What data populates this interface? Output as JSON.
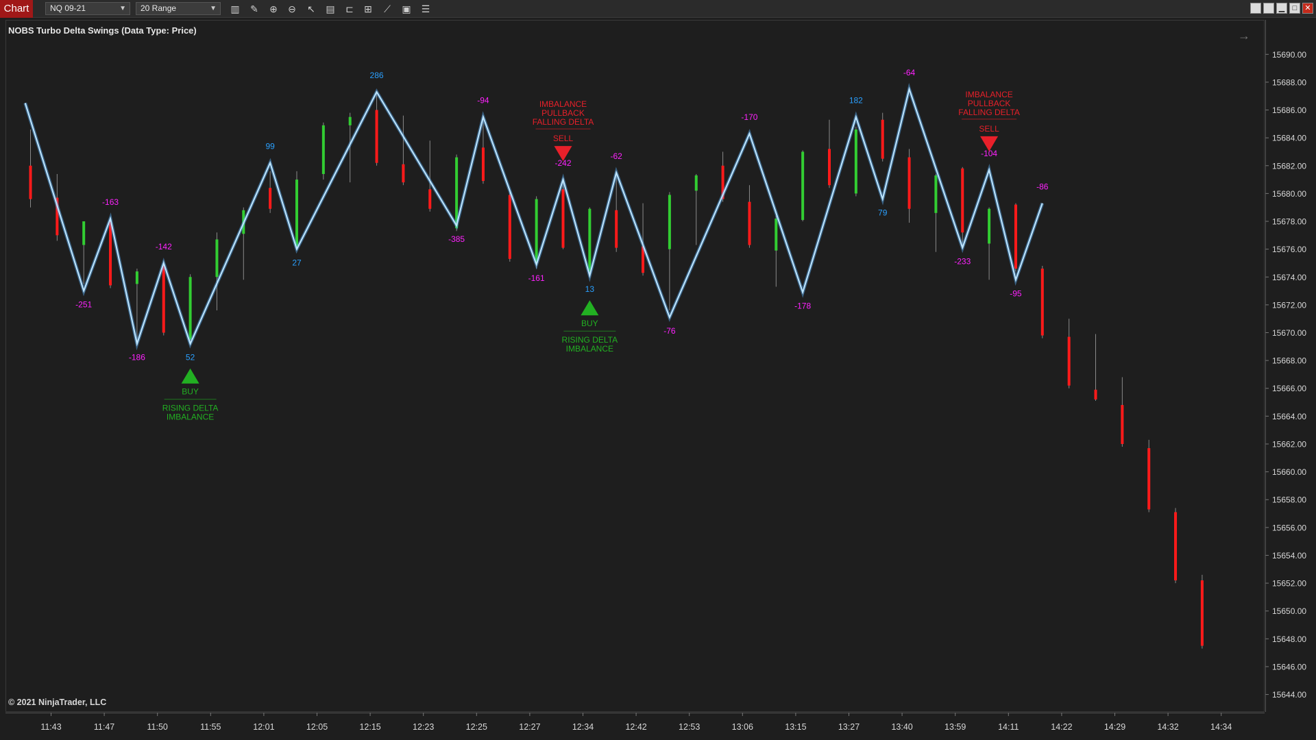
{
  "toolbar": {
    "app_tab": "Chart",
    "instrument": "NQ 09-21",
    "interval": "20 Range",
    "tools": [
      "bar-chart-icon",
      "pencil-icon",
      "zoom-in-icon",
      "zoom-out-icon",
      "pointer-icon",
      "data-box-icon",
      "strategy-icon",
      "indicators-icon",
      "drawing-tools-icon",
      "properties-icon",
      "list-icon"
    ]
  },
  "window_controls": [
    "tile-icon",
    "restore-icon",
    "minimize-icon",
    "maximize-icon",
    "close-icon"
  ],
  "chart": {
    "title": "NOBS Turbo Delta Swings (Data Type: Price)",
    "copyright": "© 2021 NinjaTrader, LLC",
    "nav_arrow": "→"
  },
  "colors": {
    "background": "#1e1e1e",
    "up_bar": "#32cd32",
    "down_bar": "#ff1a1a",
    "swing_line": "#5ab4ff",
    "swing_positive_label": "#2aa0ff",
    "swing_negative_label": "#ff22ff",
    "buy_signal": "#22b022",
    "sell_signal": "#e8202a"
  },
  "chart_data": {
    "type": "candlestick-with-swing-overlay",
    "price_axis": {
      "ticks": [
        "15690.00",
        "15688.00",
        "15686.00",
        "15684.00",
        "15682.00",
        "15680.00",
        "15678.00",
        "15676.00",
        "15674.00",
        "15672.00",
        "15670.00",
        "15668.00",
        "15666.00",
        "15664.00",
        "15662.00",
        "15660.00",
        "15658.00",
        "15656.00",
        "15654.00",
        "15652.00",
        "15650.00",
        "15648.00",
        "15646.00",
        "15644.00"
      ],
      "ylim": [
        15643.5,
        15691.5
      ]
    },
    "time_axis": {
      "ticks": [
        "11:43",
        "11:47",
        "11:50",
        "11:55",
        "12:01",
        "12:05",
        "12:15",
        "12:23",
        "12:25",
        "12:27",
        "12:34",
        "12:42",
        "12:53",
        "13:06",
        "13:15",
        "13:27",
        "13:40",
        "13:59",
        "14:11",
        "14:22",
        "14:29",
        "14:32",
        "14:34"
      ]
    },
    "candles": [
      {
        "i": 0,
        "o": 15682.0,
        "c": 15679.6,
        "h": 15684.6,
        "l": 15679.0
      },
      {
        "i": 1,
        "o": 15679.7,
        "c": 15677.0,
        "h": 15681.4,
        "l": 15676.6
      },
      {
        "i": 2,
        "o": 15676.3,
        "c": 15678.0,
        "h": 15678.0,
        "l": 15673.5
      },
      {
        "i": 3,
        "o": 15678.0,
        "c": 15673.4,
        "h": 15678.2,
        "l": 15673.2
      },
      {
        "i": 4,
        "o": 15673.5,
        "c": 15674.4,
        "h": 15674.6,
        "l": 15669.2
      },
      {
        "i": 5,
        "o": 15674.8,
        "c": 15670.0,
        "h": 15675.2,
        "l": 15669.8
      },
      {
        "i": 6,
        "o": 15669.5,
        "c": 15674.0,
        "h": 15674.2,
        "l": 15669.2
      },
      {
        "i": 7,
        "o": 15674.0,
        "c": 15676.7,
        "h": 15677.2,
        "l": 15671.6
      },
      {
        "i": 8,
        "o": 15677.1,
        "c": 15678.8,
        "h": 15679.0,
        "l": 15673.8
      },
      {
        "i": 9,
        "o": 15680.4,
        "c": 15678.9,
        "h": 15681.6,
        "l": 15678.6
      },
      {
        "i": 10,
        "o": 15676.2,
        "c": 15681.0,
        "h": 15681.6,
        "l": 15676.0
      },
      {
        "i": 11,
        "o": 15681.4,
        "c": 15684.9,
        "h": 15685.1,
        "l": 15681.0
      },
      {
        "i": 12,
        "o": 15684.9,
        "c": 15685.5,
        "h": 15685.8,
        "l": 15680.8
      },
      {
        "i": 13,
        "o": 15686.0,
        "c": 15682.2,
        "h": 15687.3,
        "l": 15682.0
      },
      {
        "i": 14,
        "o": 15682.1,
        "c": 15680.8,
        "h": 15685.6,
        "l": 15680.6
      },
      {
        "i": 15,
        "o": 15680.3,
        "c": 15678.9,
        "h": 15683.8,
        "l": 15678.7
      },
      {
        "i": 16,
        "o": 15677.5,
        "c": 15682.6,
        "h": 15682.8,
        "l": 15677.3
      },
      {
        "i": 17,
        "o": 15683.3,
        "c": 15680.9,
        "h": 15685.4,
        "l": 15680.7
      },
      {
        "i": 18,
        "o": 15679.9,
        "c": 15675.3,
        "h": 15680.1,
        "l": 15675.1
      },
      {
        "i": 19,
        "o": 15675.0,
        "c": 15679.6,
        "h": 15679.8,
        "l": 15674.6
      },
      {
        "i": 20,
        "o": 15680.3,
        "c": 15676.1,
        "h": 15681.1,
        "l": 15676.0
      },
      {
        "i": 21,
        "o": 15674.4,
        "c": 15678.9,
        "h": 15679.0,
        "l": 15674.2
      },
      {
        "i": 22,
        "o": 15678.8,
        "c": 15676.1,
        "h": 15681.5,
        "l": 15675.8
      },
      {
        "i": 23,
        "o": 15676.2,
        "c": 15674.3,
        "h": 15679.3,
        "l": 15674.1
      },
      {
        "i": 24,
        "o": 15676.0,
        "c": 15679.9,
        "h": 15680.1,
        "l": 15671.6
      },
      {
        "i": 25,
        "o": 15680.2,
        "c": 15681.3,
        "h": 15681.4,
        "l": 15676.3
      },
      {
        "i": 26,
        "o": 15682.0,
        "c": 15679.6,
        "h": 15683.0,
        "l": 15679.4
      },
      {
        "i": 27,
        "o": 15679.4,
        "c": 15676.3,
        "h": 15680.6,
        "l": 15676.1
      },
      {
        "i": 28,
        "o": 15675.9,
        "c": 15678.2,
        "h": 15678.4,
        "l": 15673.3
      },
      {
        "i": 29,
        "o": 15678.1,
        "c": 15683.0,
        "h": 15683.1,
        "l": 15678.0
      },
      {
        "i": 30,
        "o": 15683.2,
        "c": 15680.6,
        "h": 15685.3,
        "l": 15680.4
      },
      {
        "i": 31,
        "o": 15680.0,
        "c": 15684.6,
        "h": 15684.8,
        "l": 15679.8
      },
      {
        "i": 32,
        "o": 15685.3,
        "c": 15682.5,
        "h": 15685.8,
        "l": 15682.3
      },
      {
        "i": 33,
        "o": 15682.6,
        "c": 15678.9,
        "h": 15683.2,
        "l": 15677.9
      },
      {
        "i": 34,
        "o": 15678.6,
        "c": 15681.3,
        "h": 15681.4,
        "l": 15675.8
      },
      {
        "i": 35,
        "o": 15681.8,
        "c": 15677.2,
        "h": 15681.9,
        "l": 15676.1
      },
      {
        "i": 36,
        "o": 15676.4,
        "c": 15678.9,
        "h": 15679.0,
        "l": 15673.8
      },
      {
        "i": 37,
        "o": 15679.2,
        "c": 15674.6,
        "h": 15679.3,
        "l": 15674.4
      },
      {
        "i": 38,
        "o": 15674.6,
        "c": 15669.8,
        "h": 15674.8,
        "l": 15669.6
      },
      {
        "i": 39,
        "o": 15669.7,
        "c": 15666.2,
        "h": 15671.0,
        "l": 15666.0
      },
      {
        "i": 40,
        "o": 15665.9,
        "c": 15665.2,
        "h": 15669.9,
        "l": 15665.1
      },
      {
        "i": 41,
        "o": 15664.8,
        "c": 15662.0,
        "h": 15666.8,
        "l": 15661.8
      },
      {
        "i": 42,
        "o": 15661.7,
        "c": 15657.3,
        "h": 15662.3,
        "l": 15657.1
      },
      {
        "i": 43,
        "o": 15657.1,
        "c": 15652.2,
        "h": 15657.4,
        "l": 15652.0
      },
      {
        "i": 44,
        "o": 15652.2,
        "c": 15647.5,
        "h": 15652.6,
        "l": 15647.3
      }
    ],
    "swing_points": [
      {
        "i": -0.2,
        "p": 15686.5,
        "label": ""
      },
      {
        "i": 2,
        "p": 15673.0,
        "label": "-251",
        "pos": "below",
        "kind": "neg"
      },
      {
        "i": 3,
        "p": 15678.2,
        "label": "-163",
        "pos": "above",
        "kind": "neg"
      },
      {
        "i": 4,
        "p": 15669.2,
        "label": "-186",
        "pos": "below",
        "kind": "neg"
      },
      {
        "i": 5,
        "p": 15675.0,
        "label": "-142",
        "pos": "above",
        "kind": "neg"
      },
      {
        "i": 6,
        "p": 15669.2,
        "label": "52",
        "pos": "below",
        "kind": "pos"
      },
      {
        "i": 9,
        "p": 15682.2,
        "label": "99",
        "pos": "above",
        "kind": "pos"
      },
      {
        "i": 10,
        "p": 15676.0,
        "label": "27",
        "pos": "below",
        "kind": "pos"
      },
      {
        "i": 13,
        "p": 15687.3,
        "label": "286",
        "pos": "above",
        "kind": "pos"
      },
      {
        "i": 16,
        "p": 15677.7,
        "label": "-385",
        "pos": "below",
        "kind": "neg"
      },
      {
        "i": 17,
        "p": 15685.5,
        "label": "-94",
        "pos": "above",
        "kind": "neg"
      },
      {
        "i": 19,
        "p": 15674.9,
        "label": "-161",
        "pos": "below",
        "kind": "neg"
      },
      {
        "i": 20,
        "p": 15681.0,
        "label": "-242",
        "pos": "above",
        "kind": "neg"
      },
      {
        "i": 21,
        "p": 15674.1,
        "label": "13",
        "pos": "below",
        "kind": "pos"
      },
      {
        "i": 22,
        "p": 15681.5,
        "label": "-62",
        "pos": "above",
        "kind": "neg"
      },
      {
        "i": 24,
        "p": 15671.1,
        "label": "-76",
        "pos": "below",
        "kind": "neg"
      },
      {
        "i": 27,
        "p": 15684.3,
        "label": "-170",
        "pos": "above",
        "kind": "neg"
      },
      {
        "i": 29,
        "p": 15672.9,
        "label": "-178",
        "pos": "below",
        "kind": "neg"
      },
      {
        "i": 31,
        "p": 15685.5,
        "label": "182",
        "pos": "above",
        "kind": "pos"
      },
      {
        "i": 32,
        "p": 15679.6,
        "label": "79",
        "pos": "below",
        "kind": "pos"
      },
      {
        "i": 33,
        "p": 15687.5,
        "label": "-64",
        "pos": "above",
        "kind": "neg"
      },
      {
        "i": 35,
        "p": 15676.1,
        "label": "-233",
        "pos": "below",
        "kind": "neg"
      },
      {
        "i": 36,
        "p": 15681.7,
        "label": "-104",
        "pos": "above",
        "kind": "neg"
      },
      {
        "i": 37,
        "p": 15673.8,
        "label": "-95",
        "pos": "below",
        "kind": "neg"
      },
      {
        "i": 38,
        "p": 15679.3,
        "label": "-86",
        "pos": "above",
        "kind": "neg"
      }
    ],
    "signals": [
      {
        "type": "buy",
        "i": 6,
        "p": 15669.2,
        "text": "BUY",
        "caption": [
          "RISING DELTA",
          "IMBALANCE"
        ]
      },
      {
        "type": "buy",
        "i": 21,
        "p": 15674.1,
        "text": "BUY",
        "caption": [
          "RISING DELTA",
          "IMBALANCE"
        ]
      },
      {
        "type": "sell",
        "i": 20,
        "p": 15681.0,
        "text": "SELL",
        "caption": [
          "IMBALANCE",
          "PULLBACK",
          "FALLING DELTA"
        ]
      },
      {
        "type": "sell",
        "i": 36,
        "p": 15681.7,
        "text": "SELL",
        "caption": [
          "IMBALANCE",
          "PULLBACK",
          "FALLING DELTA"
        ]
      }
    ]
  }
}
